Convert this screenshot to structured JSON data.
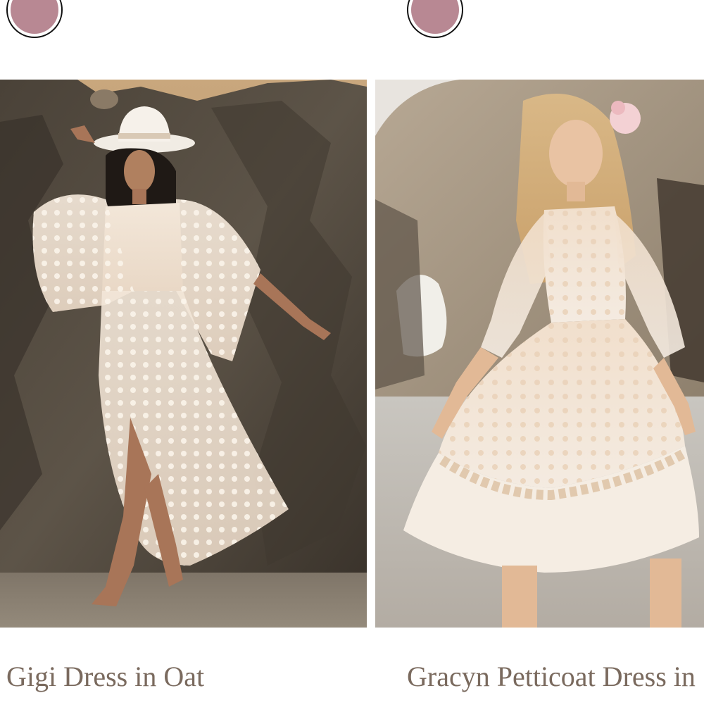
{
  "colors": {
    "swatch": "#b88893",
    "title_text": "#7a6a5e"
  },
  "products": [
    {
      "title": "Gigi Dress in Oat",
      "swatch_color": "#b88893",
      "image_alt": "Woman in white hat wearing oat lace polka-dot dress on rocky beach"
    },
    {
      "title": "Gracyn Petticoat Dress in",
      "swatch_color": "#b88893",
      "image_alt": "Girl in cream lace petticoat dress with flower in hair on beach"
    }
  ]
}
